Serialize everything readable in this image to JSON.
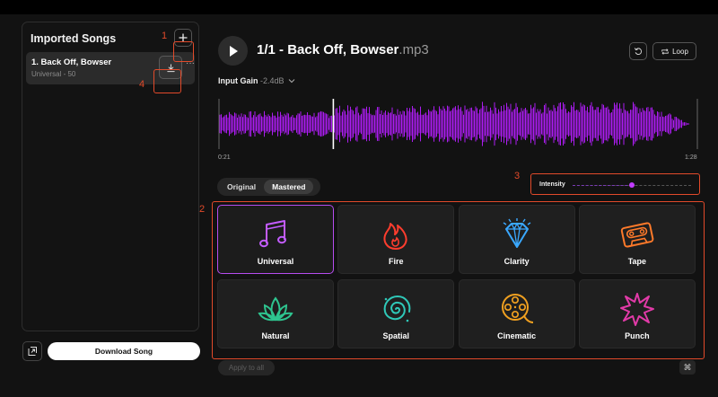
{
  "sidebar": {
    "title": "Imported Songs",
    "song": {
      "title": "1. Back Off, Bowser",
      "subtitle": "Universal - 50"
    },
    "more_label": "···",
    "download_button": "Download Song"
  },
  "player": {
    "track_index": "1/1 - ",
    "track_name": "Back Off, Bowser",
    "track_ext": ".mp3",
    "loop_label": "Loop",
    "input_gain_label": "Input Gain",
    "input_gain_value": "-2.4dB",
    "time_start": "0:21",
    "time_end": "1:28",
    "playhead_fraction": 0.24,
    "waveform_color": "#b51dff"
  },
  "mode_toggle": {
    "options": [
      "Original",
      "Mastered"
    ],
    "selected": "Mastered"
  },
  "intensity": {
    "label": "Intensity",
    "value": 0.5
  },
  "presets": [
    {
      "label": "Universal",
      "icon": "music-notes-icon",
      "color": "#c35cff",
      "selected": true
    },
    {
      "label": "Fire",
      "icon": "fire-icon",
      "color": "#ff3d2e",
      "selected": false
    },
    {
      "label": "Clarity",
      "icon": "diamond-icon",
      "color": "#3aa8ff",
      "selected": false
    },
    {
      "label": "Tape",
      "icon": "cassette-tape-icon",
      "color": "#ff7a2a",
      "selected": false
    },
    {
      "label": "Natural",
      "icon": "lotus-icon",
      "color": "#2ec48f",
      "selected": false
    },
    {
      "label": "Spatial",
      "icon": "spiral-galaxy-icon",
      "color": "#2fc8b8",
      "selected": false
    },
    {
      "label": "Cinematic",
      "icon": "film-reel-icon",
      "color": "#f0a020",
      "selected": false
    },
    {
      "label": "Punch",
      "icon": "burst-icon",
      "color": "#e23aa8",
      "selected": false
    }
  ],
  "apply_all_label": "Apply to all",
  "cmd_label": "⌘",
  "annotations": [
    "1",
    "2",
    "3",
    "4"
  ],
  "colors": {
    "accent": "#b64cf0",
    "annotation": "#e24a2a"
  }
}
